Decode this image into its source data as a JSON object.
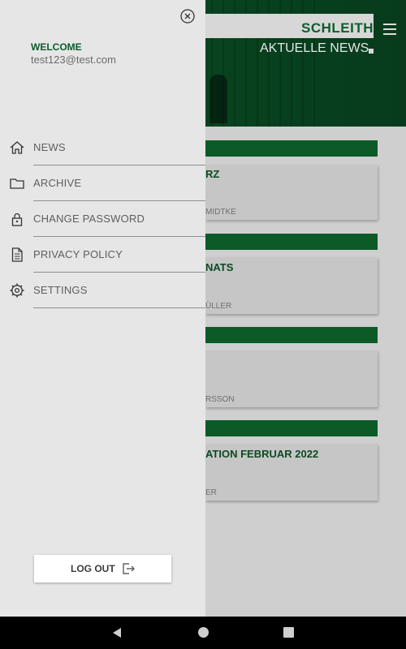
{
  "app": {
    "brand": "SCHLEITH",
    "page_title": "AKTUELLE NEWS",
    "cards": [
      {
        "title": "RZ",
        "author": "MIDTKE"
      },
      {
        "title": "NATS",
        "author": "ÜLLER"
      },
      {
        "title": "",
        "author": "RSSON"
      },
      {
        "title": "ATION FEBRUAR 2022",
        "author": "ER"
      }
    ]
  },
  "drawer": {
    "welcome": "WELCOME",
    "email": "test123@test.com",
    "items": [
      {
        "label": "NEWS",
        "icon": "home-icon"
      },
      {
        "label": "ARCHIVE",
        "icon": "folder-icon"
      },
      {
        "label": "CHANGE PASSWORD",
        "icon": "lock-icon"
      },
      {
        "label": "PRIVACY POLICY",
        "icon": "document-icon"
      },
      {
        "label": "SETTINGS",
        "icon": "gear-icon"
      }
    ],
    "logout_label": "LOG OUT"
  },
  "colors": {
    "brand_green": "#0c5c2a",
    "drawer_bg": "#e6e6e6"
  }
}
